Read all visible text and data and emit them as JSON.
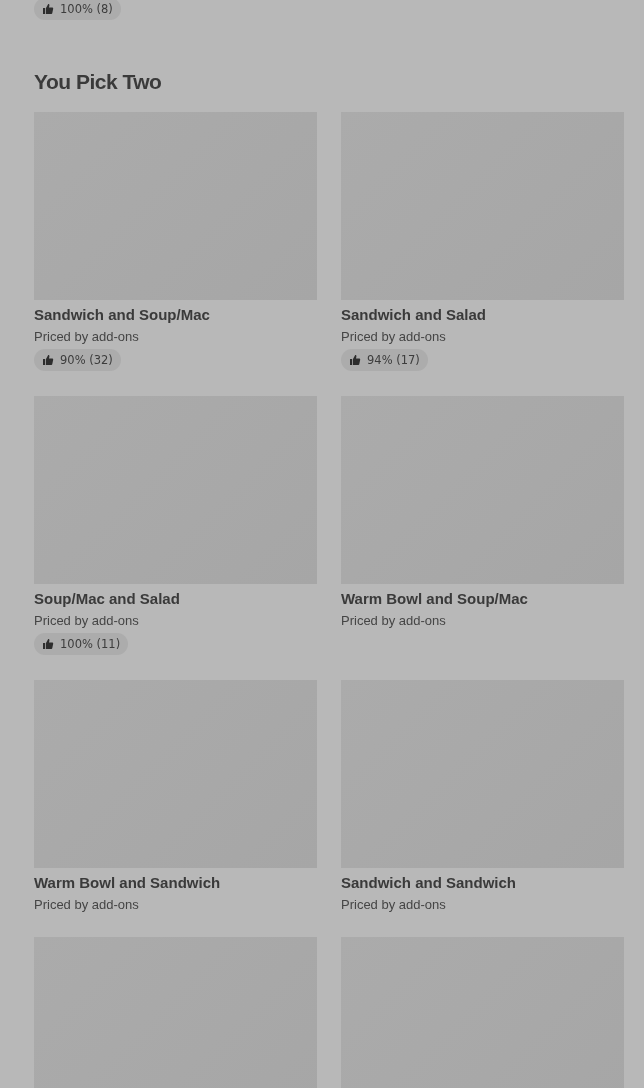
{
  "previous_item_rating": {
    "text": "100% (8)"
  },
  "section": {
    "title": "You Pick Two",
    "items": [
      {
        "kind": "card",
        "title": "Sandwich and Soup/Mac",
        "price": "Priced by add-ons",
        "rating": "90% (32)"
      },
      {
        "kind": "card",
        "title": "Sandwich and Salad",
        "price": "Priced by add-ons",
        "rating": "94% (17)"
      },
      {
        "kind": "card",
        "title": "Soup/Mac and Salad",
        "price": "Priced by add-ons",
        "rating": "100% (11)"
      },
      {
        "kind": "card",
        "title": "Warm Bowl and Soup/Mac",
        "price": "Priced by add-ons"
      },
      {
        "kind": "card",
        "title": "Warm Bowl and Sandwich",
        "price": "Priced by add-ons"
      },
      {
        "kind": "card",
        "title": "Sandwich and Sandwich",
        "price": "Priced by add-ons"
      },
      {
        "kind": "image-only"
      },
      {
        "kind": "image-only"
      }
    ]
  }
}
